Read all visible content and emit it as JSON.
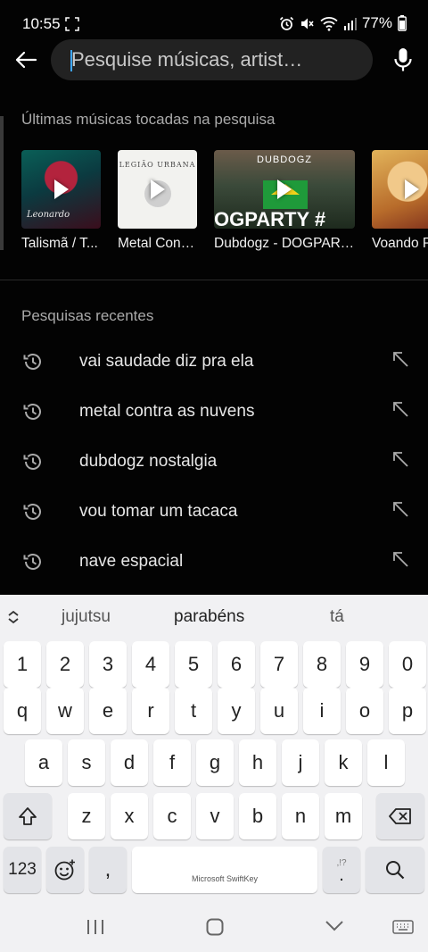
{
  "status_bar": {
    "time": "10:55",
    "battery": "77%"
  },
  "search": {
    "placeholder": "Pesquise músicas, artist…"
  },
  "recently_played": {
    "title": "Últimas músicas tocadas na pesquisa",
    "items": [
      {
        "caption": "Talismã / T...",
        "thumb_text": "Leonardo"
      },
      {
        "caption": "Metal Contr...",
        "thumb_text": "LEGIÃO URBANA"
      },
      {
        "caption": "Dubdogz - DOGPART...",
        "thumb_text": "DUBDOGZ",
        "thumb_text2": "OGPARTY #"
      },
      {
        "caption": "Voando P"
      }
    ]
  },
  "recent_searches": {
    "title": "Pesquisas recentes",
    "items": [
      "vai saudade diz pra ela",
      "metal contra as nuvens",
      "dubdogz nostalgia",
      "vou tomar um tacaca",
      "nave espacial"
    ]
  },
  "keyboard": {
    "suggestions": [
      "jujutsu",
      "parabéns",
      "tá"
    ],
    "number_row": [
      "1",
      "2",
      "3",
      "4",
      "5",
      "6",
      "7",
      "8",
      "9",
      "0"
    ],
    "row1": [
      "q",
      "w",
      "e",
      "r",
      "t",
      "y",
      "u",
      "i",
      "o",
      "p"
    ],
    "row2": [
      "a",
      "s",
      "d",
      "f",
      "g",
      "h",
      "j",
      "k",
      "l"
    ],
    "row3": [
      "z",
      "x",
      "c",
      "v",
      "b",
      "n",
      "m"
    ],
    "numbers_key": "123",
    "comma_key": ",",
    "space_label": "Microsoft SwiftKey",
    "period_key": ".",
    "period_alt": ",!?"
  },
  "colors": {
    "background": "#030303",
    "search_field": "#222222",
    "caret": "#3ea6ff",
    "keyboard_bg": "#f1f1f3"
  }
}
